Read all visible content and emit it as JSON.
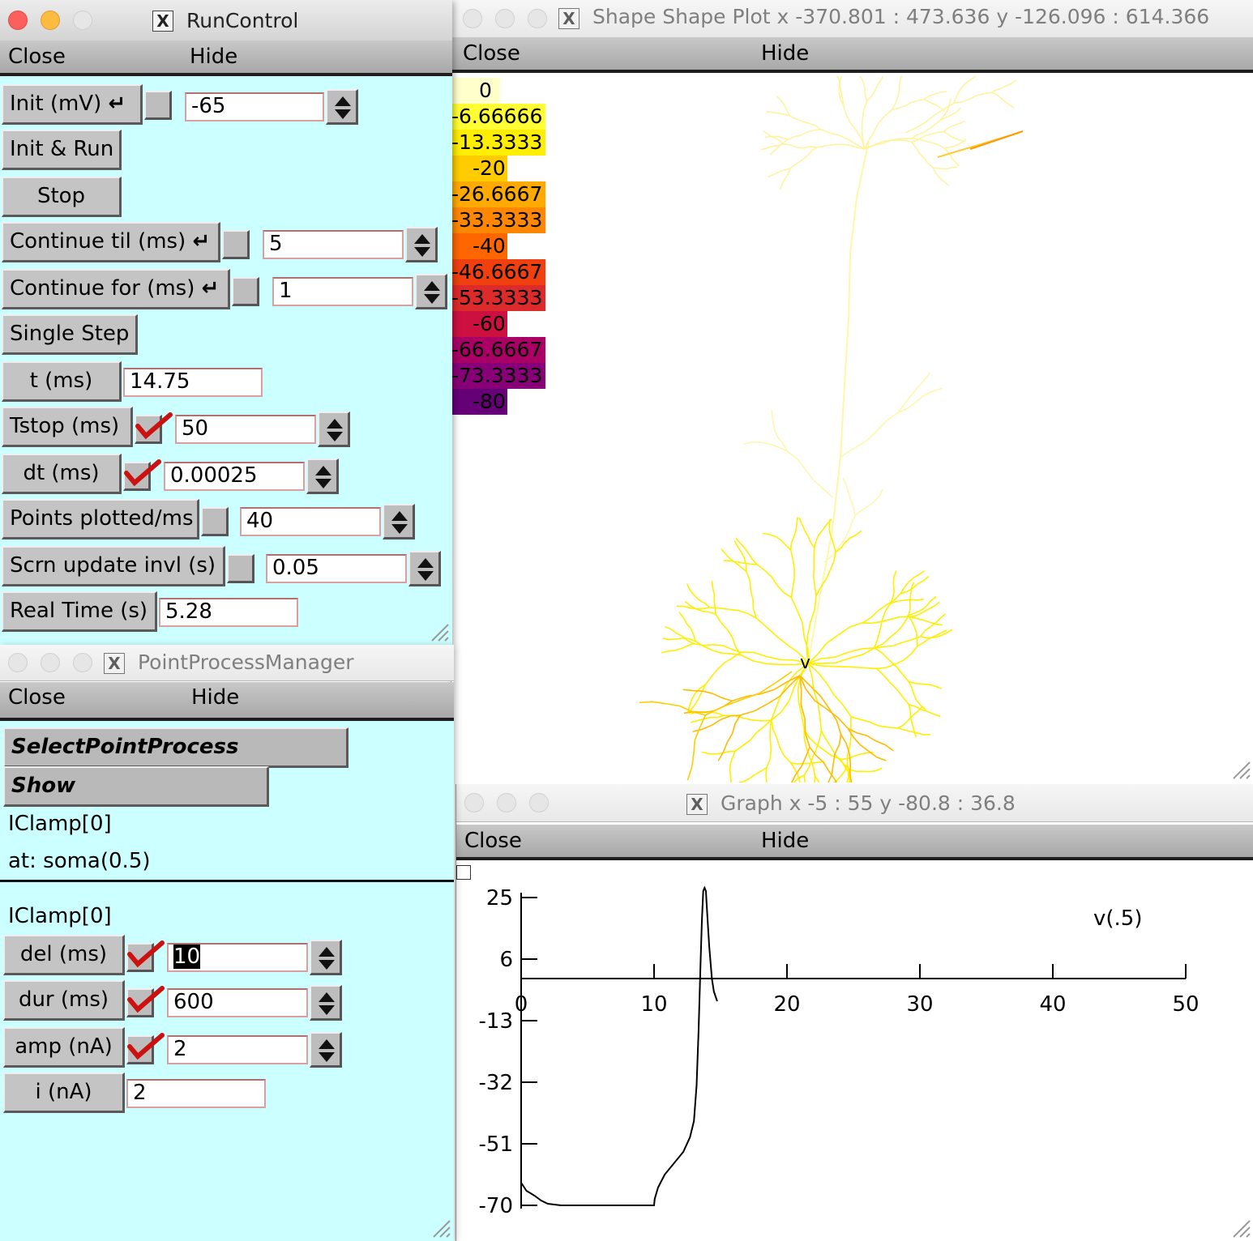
{
  "run_control": {
    "title": "RunControl",
    "menu": {
      "close": "Close",
      "hide": "Hide"
    },
    "init": {
      "label": "Init (mV)",
      "value": "-65"
    },
    "init_run": {
      "label": "Init & Run"
    },
    "stop": {
      "label": "Stop"
    },
    "continue_til": {
      "label": "Continue til (ms)",
      "value": "5"
    },
    "continue_for": {
      "label": "Continue for (ms)",
      "value": "1"
    },
    "single_step": {
      "label": "Single Step"
    },
    "t": {
      "label": "t (ms)",
      "value": "14.75"
    },
    "tstop": {
      "label": "Tstop (ms)",
      "value": "50",
      "checked": true
    },
    "dt": {
      "label": "dt (ms)",
      "value": "0.00025",
      "checked": true
    },
    "points_plotted": {
      "label": "Points plotted/ms",
      "value": "40"
    },
    "scrn_update": {
      "label": "Scrn update invl (s)",
      "value": "0.05"
    },
    "real_time": {
      "label": "Real Time (s)",
      "value": "5.28"
    },
    "return_glyph": "↵"
  },
  "point_process_manager": {
    "title": "PointProcessManager",
    "menu": {
      "close": "Close",
      "hide": "Hide"
    },
    "select_button": "SelectPointProcess",
    "show_button": "Show",
    "process_name": "IClamp[0]",
    "location": "at: soma(0.5)",
    "param_header": "IClamp[0]",
    "del": {
      "label": "del (ms)",
      "value": "10",
      "checked": true
    },
    "dur": {
      "label": "dur (ms)",
      "value": "600",
      "checked": true
    },
    "amp": {
      "label": "amp (nA)",
      "value": "2",
      "checked": true
    },
    "i": {
      "label": "i (nA)",
      "value": "2"
    }
  },
  "shape_plot": {
    "title": "Shape Shape Plot x -370.801 : 473.636  y -126.096 : 614.366",
    "menu": {
      "close": "Close",
      "hide": "Hide"
    },
    "marker_label": "v",
    "legend": [
      {
        "value": "0",
        "color": "#ffffcc"
      },
      {
        "value": "-6.66666",
        "color": "#ffff33"
      },
      {
        "value": "-13.3333",
        "color": "#ffee00"
      },
      {
        "value": "-20",
        "color": "#ffcc00"
      },
      {
        "value": "-26.6667",
        "color": "#ffaa00"
      },
      {
        "value": "-33.3333",
        "color": "#ff8800"
      },
      {
        "value": "-40",
        "color": "#ff6600"
      },
      {
        "value": "-46.6667",
        "color": "#f04010"
      },
      {
        "value": "-53.3333",
        "color": "#dd2a2a"
      },
      {
        "value": "-60",
        "color": "#cc1040"
      },
      {
        "value": "-66.6667",
        "color": "#aa0066"
      },
      {
        "value": "-73.3333",
        "color": "#880077"
      },
      {
        "value": "-80",
        "color": "#660077"
      }
    ]
  },
  "graph": {
    "title": "Graph  x -5 : 55  y -80.8 : 36.8",
    "menu": {
      "close": "Close",
      "hide": "Hide"
    }
  },
  "chart_data": {
    "type": "line",
    "title": "",
    "xlabel": "",
    "ylabel": "",
    "xlim": [
      -5,
      55
    ],
    "ylim": [
      -80.8,
      36.8
    ],
    "x_ticks": [
      0,
      10,
      20,
      30,
      40,
      50
    ],
    "y_ticks": [
      25,
      6,
      -13,
      -32,
      -51,
      -70
    ],
    "series": [
      {
        "name": "v(.5)",
        "color": "#000000",
        "x": [
          0,
          0.4,
          1,
          1.5,
          2,
          3,
          5,
          8,
          10,
          10.05,
          10.3,
          10.8,
          11.5,
          12.2,
          12.7,
          13.0,
          13.2,
          13.35,
          13.5,
          13.6,
          13.7,
          13.8,
          13.9,
          14.0,
          14.15,
          14.35,
          14.5,
          14.75
        ],
        "y": [
          -63,
          -65.5,
          -67,
          -68.5,
          -69.5,
          -70,
          -70,
          -70,
          -70,
          -68,
          -64.5,
          -60.5,
          -57,
          -53.5,
          -49,
          -44,
          -33,
          -16,
          5,
          18,
          27,
          28,
          27,
          20,
          10,
          0,
          -4,
          -7
        ]
      }
    ]
  }
}
